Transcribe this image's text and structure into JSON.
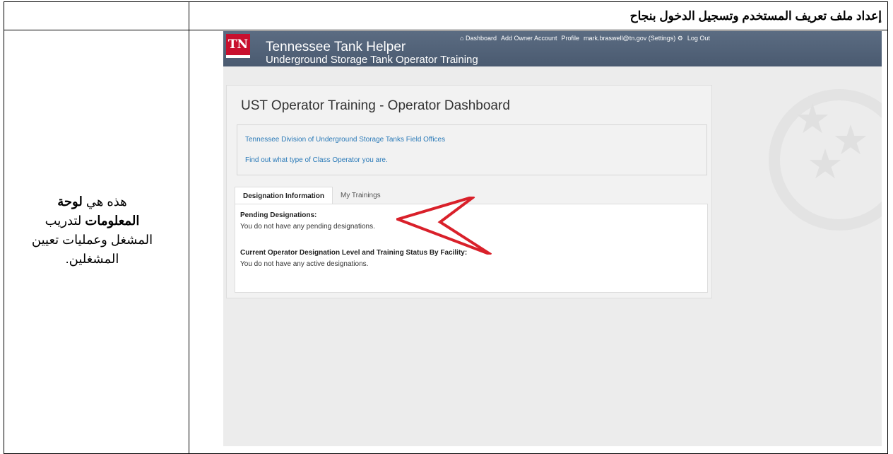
{
  "document": {
    "heading": "إعداد ملف تعريف المستخدم وتسجيل الدخول بنجاح",
    "note_prefix": "هذه هي ",
    "note_bold": "لوحة المعلومات",
    "note_rest": " لتدريب المشغل وعمليات تعيين المشغلين."
  },
  "app": {
    "logo": "TN",
    "title": "Tennessee Tank Helper",
    "subtitle": "Underground Storage Tank Operator Training",
    "nav": {
      "dashboard_icon": "home-icon",
      "dashboard": "Dashboard",
      "add_owner": "Add Owner Account",
      "profile": "Profile",
      "user": "mark.braswell@tn.gov (Settings)",
      "settings_icon": "gear-icon",
      "logout": "Log Out"
    },
    "panel_title": "UST Operator Training - Operator Dashboard",
    "links": [
      "Tennessee Division of Underground Storage Tanks Field Offices",
      "Find out what type of Class Operator you are."
    ],
    "tabs": [
      "Designation Information",
      "My Trainings"
    ],
    "pending_title": "Pending Designations:",
    "pending_text": "You do not have any pending designations.",
    "current_title": "Current Operator Designation Level and Training Status By Facility:",
    "current_text": "You do not have any active designations."
  },
  "colors": {
    "navbar": "#4a5a70",
    "logo_red": "#c8102e",
    "link": "#2a7ab8",
    "arrow": "#d9202a"
  }
}
